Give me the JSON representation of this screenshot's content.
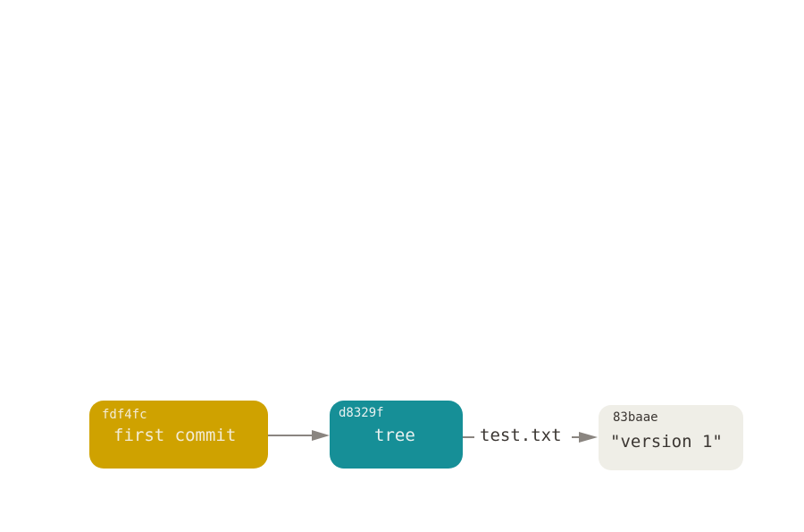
{
  "nodes": {
    "commit": {
      "hash": "fdf4fc",
      "label": "first commit",
      "color": "#cfa200"
    },
    "tree": {
      "hash": "d8329f",
      "label": "tree",
      "color": "#168f97"
    },
    "blob": {
      "hash": "83baae",
      "label": "\"version 1\"",
      "color": "#efeee7"
    }
  },
  "edges": [
    {
      "from": "commit",
      "to": "tree",
      "label": ""
    },
    {
      "from": "tree",
      "to": "blob",
      "label": "test.txt"
    }
  ],
  "edge_color": "#8a8580"
}
